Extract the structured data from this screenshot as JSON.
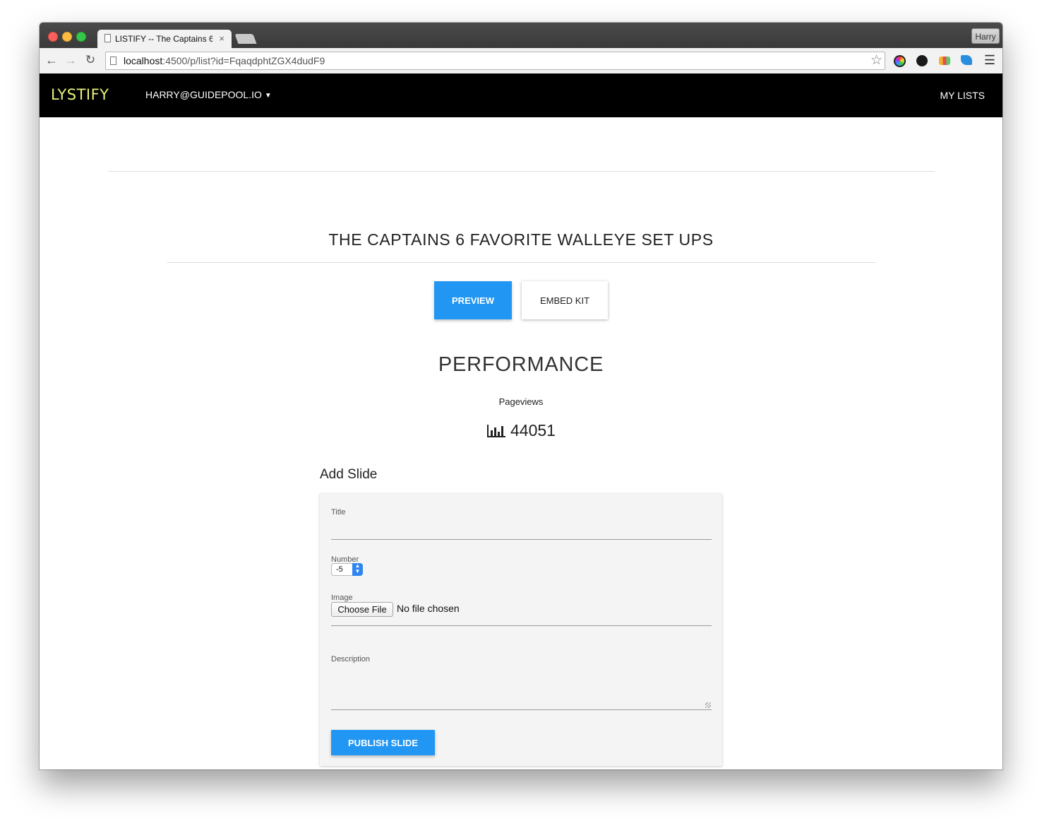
{
  "browser": {
    "tab_title": "LISTIFY -- The Captains 6",
    "tab_close": "×",
    "profile_name": "Harry",
    "url_host": "localhost",
    "url_rest": ":4500/p/list?id=FqaqdphtZGX4dudF9"
  },
  "navbar": {
    "brand": "LYSTIFY",
    "account": "HARRY@GUIDEPOOL.IO",
    "my_lists": "MY LISTS"
  },
  "list": {
    "title": "THE CAPTAINS 6 FAVORITE WALLEYE SET UPS",
    "preview_label": "PREVIEW",
    "embed_label": "EMBED KIT"
  },
  "performance": {
    "heading": "PERFORMANCE",
    "pageviews_label": "Pageviews",
    "pageviews_value": "44051"
  },
  "add_slide": {
    "heading": "Add Slide",
    "title_label": "Title",
    "title_value": "",
    "number_label": "Number",
    "number_value": "-5",
    "image_label": "Image",
    "choose_file_label": "Choose File",
    "no_file_text": "No file chosen",
    "description_label": "Description",
    "description_value": "",
    "publish_label": "PUBLISH SLIDE"
  },
  "colors": {
    "accent_blue": "#2196f3",
    "brand_yellow": "#e8f27a",
    "navbar_bg": "#000000"
  },
  "icons": {
    "back": "arrow-left-icon",
    "forward": "arrow-right-icon",
    "reload": "reload-icon",
    "bookmark": "star-icon",
    "menu": "hamburger-icon",
    "pageviews": "bar-chart-icon"
  }
}
